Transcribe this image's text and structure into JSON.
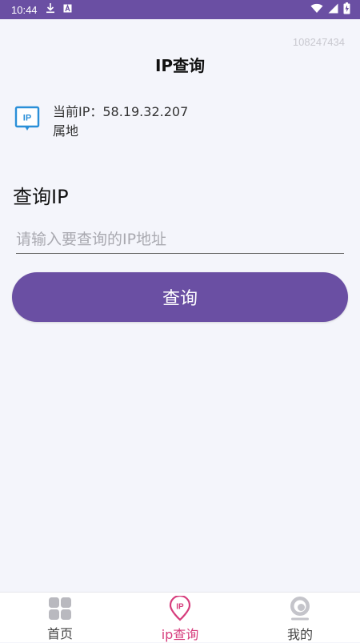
{
  "status_bar": {
    "time": "10:44",
    "icons": [
      "download-icon",
      "text-a-icon",
      "wifi-icon",
      "signal-icon",
      "battery-icon"
    ]
  },
  "app_id": "108247434",
  "header": {
    "title": "IP查询"
  },
  "current_ip": {
    "icon": "ip-monitor-icon",
    "label": "当前IP：",
    "value": "58.19.32.207",
    "location_label": "属地"
  },
  "query": {
    "section_title": "查询IP",
    "input_placeholder": "请输入要查询的IP地址",
    "input_value": "",
    "button_label": "查询"
  },
  "bottom_nav": {
    "items": [
      {
        "label": "首页",
        "icon": "grid-icon",
        "active": false
      },
      {
        "label": "ip查询",
        "icon": "ip-pin-icon",
        "active": true
      },
      {
        "label": "我的",
        "icon": "profile-icon",
        "active": false
      }
    ]
  },
  "colors": {
    "primary": "#6a4fa3",
    "accent_active": "#d63c7c",
    "background": "#f4f5fb",
    "icon_blue": "#2a8fd8"
  }
}
